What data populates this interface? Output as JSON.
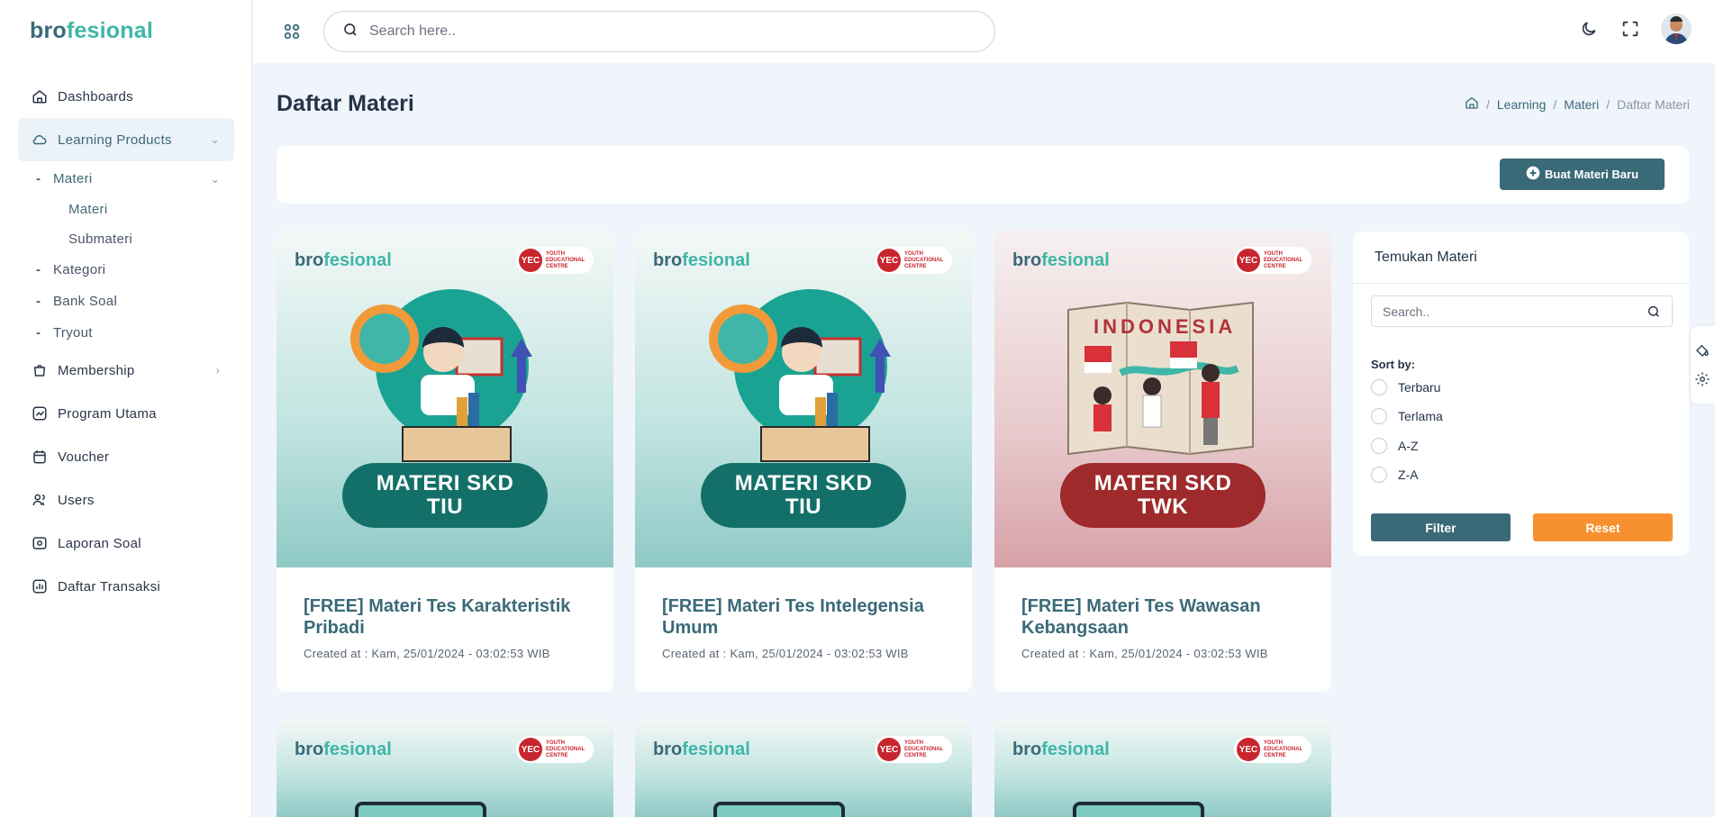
{
  "brand": {
    "part1": "bro",
    "part2": "fesi",
    "part3": "o",
    "part4": "nal"
  },
  "sidebar": {
    "items": [
      {
        "label": "Dashboards",
        "icon": "home-icon"
      },
      {
        "label": "Learning Products",
        "icon": "cloud-icon"
      },
      {
        "label": "Membership",
        "icon": "bag-icon"
      },
      {
        "label": "Program Utama",
        "icon": "chart-icon"
      },
      {
        "label": "Voucher",
        "icon": "calendar-icon"
      },
      {
        "label": "Users",
        "icon": "users-icon"
      },
      {
        "label": "Laporan Soal",
        "icon": "report-icon"
      },
      {
        "label": "Daftar Transaksi",
        "icon": "bar-chart-icon"
      }
    ],
    "sub": [
      {
        "label": "Materi"
      },
      {
        "label": "Kategori"
      },
      {
        "label": "Bank Soal"
      },
      {
        "label": "Tryout"
      }
    ],
    "sub2": [
      {
        "label": "Materi"
      },
      {
        "label": "Submateri"
      }
    ],
    "sub_dash": "-"
  },
  "search": {
    "placeholder": "Search here.."
  },
  "page": {
    "title": "Daftar Materi"
  },
  "breadcrumb": {
    "items": [
      "Learning",
      "Materi",
      "Daftar Materi"
    ],
    "sep": "/"
  },
  "actions": {
    "new_label": "Buat Materi Baru"
  },
  "cards": [
    {
      "badge_line1": "MATERI SKD",
      "badge_line2": "TIU",
      "title": "[FREE] Materi Tes Karakteristik Pribadi",
      "date": "Created at : Kam, 25/01/2024 - 03:02:53 WIB",
      "theme": "teal"
    },
    {
      "badge_line1": "MATERI SKD",
      "badge_line2": "TIU",
      "title": "[FREE] Materi Tes Intelegensia Umum",
      "date": "Created at : Kam, 25/01/2024 - 03:02:53 WIB",
      "theme": "teal"
    },
    {
      "badge_line1": "MATERI SKD",
      "badge_line2": "TWK",
      "title": "[FREE] Materi Tes Wawasan Kebangsaan",
      "date": "Created at : Kam, 25/01/2024 - 03:02:53 WIB",
      "theme": "rose",
      "map_text": "INDONESIA"
    }
  ],
  "card_brand": "brofesional",
  "yec": {
    "mark": "YEC",
    "text1": "YOUTH",
    "text2": "EDUCATIONAL",
    "text3": "CENTRE"
  },
  "filter": {
    "title": "Temukan Materi",
    "search_placeholder": "Search..",
    "sort_label": "Sort by:",
    "options": [
      "Terbaru",
      "Terlama",
      "A-Z",
      "Z-A"
    ],
    "filter_label": "Filter",
    "reset_label": "Reset"
  },
  "colors": {
    "primary": "#3a6a78",
    "accent": "#3fb6a8",
    "orange": "#f7902f",
    "teal_badge": "#137068",
    "red_badge": "#9e2a2b"
  }
}
